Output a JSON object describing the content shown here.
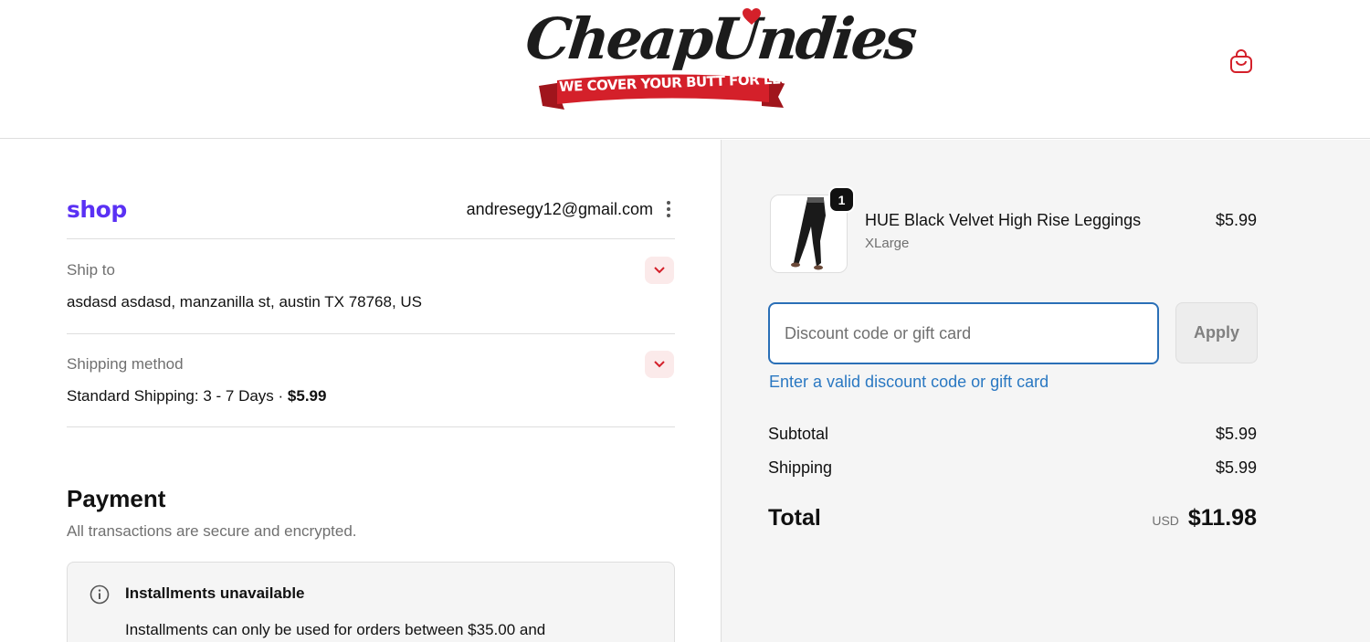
{
  "header": {
    "logo_text": "CheapUndies",
    "logo_tagline": "WE COVER YOUR BUTT FOR LESS",
    "cart_icon": "shopping-bag-icon"
  },
  "account": {
    "shop_label": "shop",
    "email": "andresegy12@gmail.com",
    "menu_icon": "kebab-menu-icon"
  },
  "ship_to": {
    "label": "Ship to",
    "value": "asdasd asdasd, manzanilla st, austin TX 78768, US",
    "toggle_icon": "chevron-down-icon"
  },
  "shipping_method": {
    "label": "Shipping method",
    "value": "Standard Shipping: 3 - 7 Days · ",
    "price": "$5.99",
    "toggle_icon": "chevron-down-icon"
  },
  "payment": {
    "title": "Payment",
    "subtitle": "All transactions are secure and encrypted.",
    "notice_title": "Installments unavailable",
    "notice_body": "Installments can only be used for orders between $35.00 and",
    "notice_icon": "info-icon"
  },
  "order": {
    "item": {
      "quantity": "1",
      "name": "HUE Black Velvet High Rise Leggings",
      "variant": "XLarge",
      "price": "$5.99"
    },
    "discount": {
      "placeholder": "Discount code or gift card",
      "value": "",
      "apply_label": "Apply",
      "error": "Enter a valid discount code or gift card"
    },
    "subtotal_label": "Subtotal",
    "subtotal_value": "$5.99",
    "shipping_label": "Shipping",
    "shipping_value": "$5.99",
    "total_label": "Total",
    "total_currency": "USD",
    "total_value": "$11.98"
  },
  "colors": {
    "brand_red": "#d4202a",
    "shop_purple": "#5a31f4",
    "focus_blue": "#2a6fb7",
    "link_blue": "#2a78c2"
  }
}
